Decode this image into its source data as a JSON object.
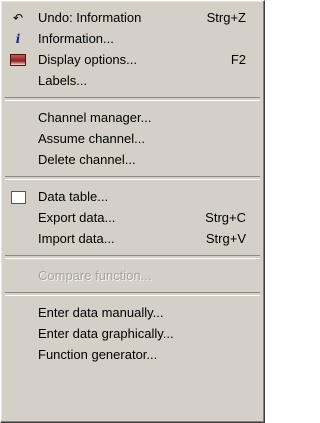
{
  "menu": {
    "items": [
      {
        "icon": "undo-icon",
        "label": "Undo: Information",
        "shortcut": "Strg+Z"
      },
      {
        "icon": "information-icon",
        "label": "Information..."
      },
      {
        "icon": "display-options-icon",
        "label": "Display options...",
        "shortcut": "F2"
      },
      {
        "label": "Labels..."
      },
      {
        "label": "Channel manager..."
      },
      {
        "label": "Assume channel..."
      },
      {
        "label": "Delete channel..."
      },
      {
        "icon": "data-table-icon",
        "label": "Data table..."
      },
      {
        "label": "Export data...",
        "shortcut": "Strg+C"
      },
      {
        "label": "Import data...",
        "shortcut": "Strg+V"
      },
      {
        "label": "Compare function...",
        "disabled": true
      },
      {
        "label": "Enter data manually..."
      },
      {
        "label": "Enter data graphically..."
      },
      {
        "label": "Function generator..."
      }
    ]
  }
}
